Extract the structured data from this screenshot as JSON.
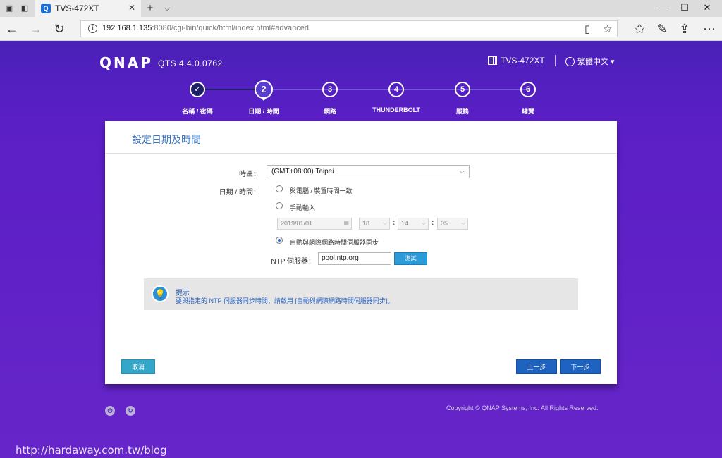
{
  "browser": {
    "tab_title": "TVS-472XT",
    "url_host": "192.168.1.135",
    "url_rest": ":8080/cgi-bin/quick/html/index.html#advanced"
  },
  "header": {
    "logo": "QNAP",
    "version": "QTS 4.4.0.0762",
    "device": "TVS-472XT",
    "language": "繁體中文"
  },
  "steps": [
    {
      "num": "✓",
      "label": "名稱 / 密碼",
      "state": "done"
    },
    {
      "num": "2",
      "label": "日期 / 時間",
      "state": "active"
    },
    {
      "num": "3",
      "label": "網路",
      "state": "pending"
    },
    {
      "num": "4",
      "label": "THUNDERBOLT",
      "state": "pending"
    },
    {
      "num": "5",
      "label": "服務",
      "state": "pending"
    },
    {
      "num": "6",
      "label": "總覽",
      "state": "pending"
    }
  ],
  "panel": {
    "title": "設定日期及時間",
    "timezone_label": "時區：",
    "timezone_value": "(GMT+08:00) Taipei",
    "datetime_label": "日期 / 時間：",
    "opt_sync_device": "與電腦 / 裝置時間一致",
    "opt_manual": "手動輸入",
    "date_value": "2019/01/01",
    "hour_value": "18",
    "minute_value": "14",
    "second_value": "05",
    "opt_ntp": "自動與網際網路時間伺服器同步",
    "selected_option": "ntp",
    "ntp_label": "NTP 伺服器：",
    "ntp_value": "pool.ntp.org",
    "test_button": "測試",
    "tip_title": "提示",
    "tip_text": "要與指定的 NTP 伺服器同步時間，請啟用 [自動與網際網路時間伺服器同步]。",
    "cancel_button": "取消",
    "prev_button": "上一步",
    "next_button": "下一步"
  },
  "footer": {
    "copyright": "Copyright © QNAP Systems, Inc. All Rights Reserved.",
    "watermark": "http://hardaway.com.tw/blog"
  },
  "colors": {
    "background": "#5b1fc6",
    "accent": "#1f63c1",
    "step_done": "#1e2066"
  }
}
